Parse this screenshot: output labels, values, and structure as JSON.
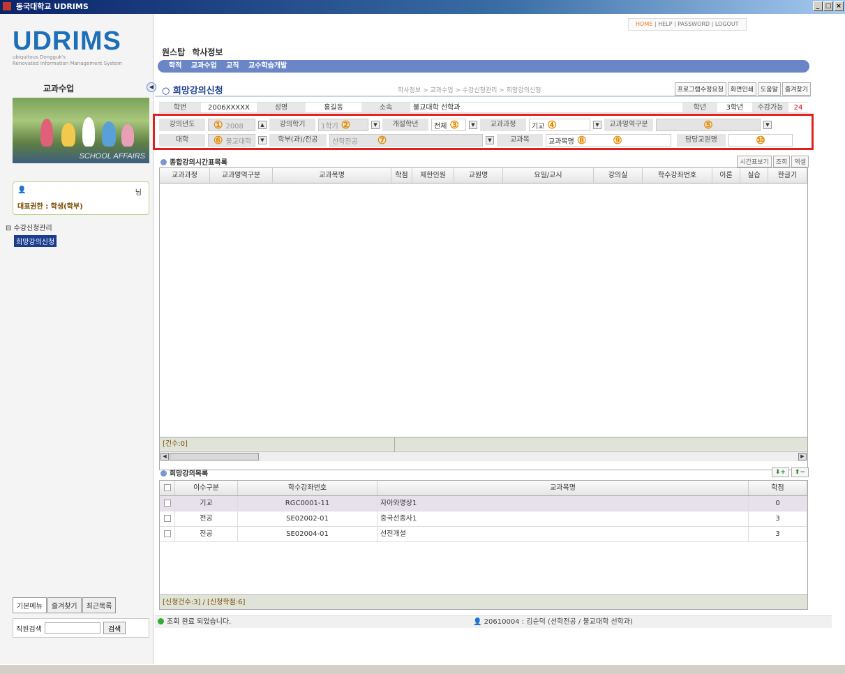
{
  "window": {
    "title": "동국대학교 UDRIMS",
    "controls": [
      "_",
      "□",
      "×"
    ]
  },
  "logo": {
    "text": "UDRIMS",
    "sub1": "ubiquitous Dongguk's",
    "sub2": "Renovated Information Management System"
  },
  "top_links": {
    "home": "HOME",
    "help": "HELP",
    "password": "PASSWORD",
    "logout": "LOGOUT"
  },
  "top_menu": {
    "one_stop": "원스탑",
    "academic": "학사정보"
  },
  "sub_menu": [
    "학적",
    "교과수업",
    "교직",
    "교수학습개발"
  ],
  "sidebar": {
    "title": "교과수업",
    "image_caption": "SCHOOL AFFAIRS",
    "user_suffix": "님",
    "role": "대표권한 : 학생(학부)",
    "tree_parent": "수강신청관리",
    "tree_child": "희망강의신청",
    "tabs": [
      "기본메뉴",
      "즐겨찾기",
      "최근목록"
    ],
    "search_label": "직원검색",
    "search_button": "검색"
  },
  "page": {
    "collapse_glyph": "◀▶",
    "title": "희망강의신청",
    "breadcrumb": "학사정보 > 교과수업 > 수강신청관리 > 희망강의신청",
    "buttons": [
      "프로그램수정요청",
      "화면인쇄",
      "도움말",
      "즐겨찾기"
    ]
  },
  "info": {
    "student_no_label": "학번",
    "student_no": "2006XXXXX",
    "name_label": "성명",
    "name": "홍길동",
    "dept_label": "소속",
    "dept": "불교대학 선학과",
    "year_label": "학년",
    "year": "3학년",
    "credits_label": "수강가능학점",
    "credits": "24"
  },
  "search": {
    "year_label": "강의년도",
    "year": "2008",
    "term_label": "강의학기",
    "term": "1학기",
    "grade_label": "개설학년",
    "grade": "전체",
    "course_label": "교과과정",
    "course": "기교",
    "area_label": "교과영역구분",
    "area": "",
    "college_label": "대학",
    "college": "불교대학",
    "dept_label": "학부(과)/전공",
    "dept": "선학전공",
    "subject_label": "교과목",
    "subject_type": "교과목명",
    "prof_label": "담당교원명",
    "markers": [
      "①",
      "②",
      "③",
      "④",
      "⑤",
      "⑥",
      "⑦",
      "⑧",
      "⑨",
      "⑩"
    ]
  },
  "timetable": {
    "title": "종합강의시간표목록",
    "buttons": [
      "시간표보기",
      "조회",
      "엑셀"
    ],
    "columns": [
      "교과과정",
      "교과영역구분",
      "교과목명",
      "학점",
      "제한인원",
      "교원명",
      "요일/교시",
      "강의실",
      "학수강좌번호",
      "이론",
      "실습",
      "한글기"
    ],
    "count": "[건수:0]"
  },
  "wishlist": {
    "title": "희망강의목록",
    "columns": [
      "이수구분",
      "학수강좌번호",
      "교과목명",
      "학점"
    ],
    "rows": [
      {
        "type": "기교",
        "code": "RGC0001-11",
        "name": "자아와명상1",
        "credit": "0"
      },
      {
        "type": "전공",
        "code": "SE02002-01",
        "name": "중국선종사1",
        "credit": "3"
      },
      {
        "type": "전공",
        "code": "SE02004-01",
        "name": "선전개설",
        "credit": "3"
      }
    ],
    "summary": "[신청건수:3] / [신청학점:6]"
  },
  "status": {
    "message": "조회 완료 되었습니다.",
    "user": "20610004 : 김순덕 (선학전공 / 불교대학 선학과)"
  }
}
